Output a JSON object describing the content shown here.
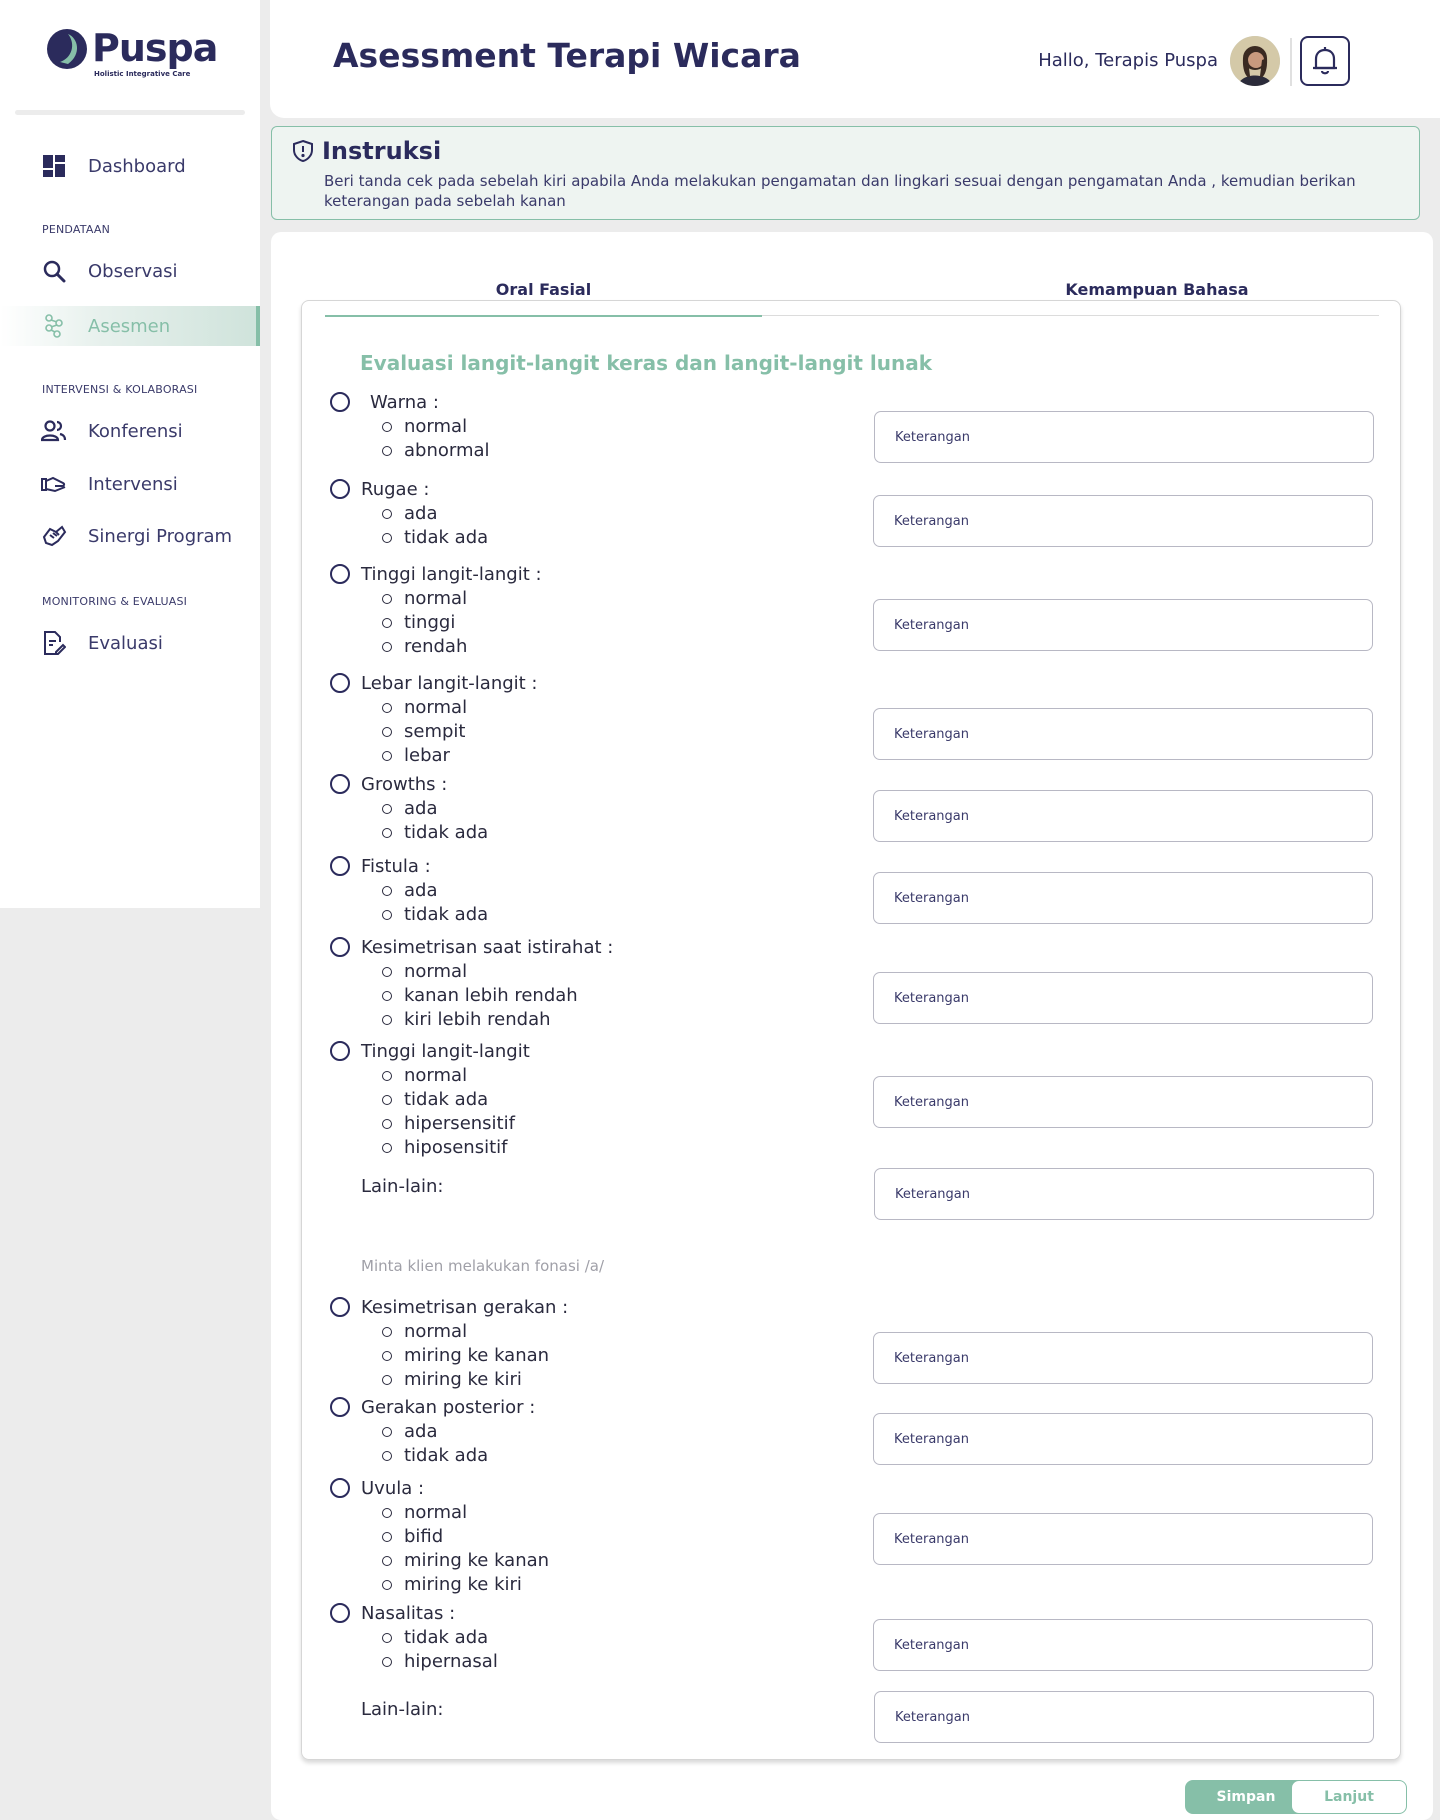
{
  "app": {
    "logo_title": "Puspa",
    "logo_subtitle": "Holistic Integrative Care"
  },
  "sidebar": {
    "items": [
      {
        "label": "Dashboard",
        "icon": "dashboard-icon"
      },
      {
        "label": "Observasi",
        "icon": "search-icon"
      },
      {
        "label": "Asesmen",
        "icon": "molecule-icon",
        "active": true
      },
      {
        "label": "Konferensi",
        "icon": "people-icon"
      },
      {
        "label": "Intervensi",
        "icon": "hand-icon"
      },
      {
        "label": "Sinergi Program",
        "icon": "handshake-icon"
      },
      {
        "label": "Evaluasi",
        "icon": "document-edit-icon"
      }
    ],
    "sections": [
      "PENDATAAN",
      "INTERVENSI & KOLABORASI",
      "MONITORING & EVALUASI"
    ]
  },
  "header": {
    "title": "Asessment Terapi Wicara",
    "greeting": "Hallo, Terapis Puspa"
  },
  "instruction": {
    "title": "Instruksi",
    "text": "Beri tanda cek pada sebelah kiri apabila Anda melakukan pengamatan dan lingkari sesuai dengan pengamatan Anda , kemudian berikan keterangan pada sebelah kanan"
  },
  "tabs": [
    {
      "label": "Oral Fasial",
      "active": true
    },
    {
      "label": "Kemampuan Bahasa",
      "active": false
    }
  ],
  "form": {
    "heading": "Evaluasi langit-langit keras dan langit-langit lunak",
    "placeholder": "Keterangan",
    "questions": [
      {
        "label": "Warna :",
        "options": [
          "normal",
          "abnormal"
        ]
      },
      {
        "label": "Rugae :",
        "options": [
          "ada",
          "tidak ada"
        ]
      },
      {
        "label": "Tinggi langit-langit :",
        "options": [
          "normal",
          "tinggi",
          "rendah"
        ]
      },
      {
        "label": "Lebar langit-langit :",
        "options": [
          "normal",
          "sempit",
          "lebar"
        ]
      },
      {
        "label": "Growths :",
        "options": [
          "ada",
          "tidak ada"
        ]
      },
      {
        "label": "Fistula :",
        "options": [
          "ada",
          "tidak ada"
        ]
      },
      {
        "label": "Kesimetrisan saat istirahat :",
        "options": [
          "normal",
          "kanan lebih rendah",
          "kiri lebih rendah"
        ]
      },
      {
        "label": "Tinggi langit-langit",
        "options": [
          "normal",
          "tidak ada",
          "hipersensitif",
          "hiposensitif"
        ]
      }
    ],
    "lain_label": "Lain-lain:",
    "sub_note": "Minta klien melakukan fonasi /a/",
    "questions2": [
      {
        "label": "Kesimetrisan gerakan :",
        "options": [
          "normal",
          "miring ke kanan",
          "miring ke kiri"
        ]
      },
      {
        "label": "Gerakan posterior :",
        "options": [
          "ada",
          "tidak ada"
        ]
      },
      {
        "label": "Uvula :",
        "options": [
          "normal",
          "bifid",
          "miring ke kanan",
          "miring ke kiri"
        ]
      },
      {
        "label": "Nasalitas :",
        "options": [
          "tidak ada",
          "hipernasal"
        ]
      }
    ],
    "lain_label2": "Lain-lain:"
  },
  "actions": {
    "save": "Simpan",
    "next": "Lanjut"
  },
  "colors": {
    "primary": "#2b2b5c",
    "accent": "#86bfa8"
  }
}
